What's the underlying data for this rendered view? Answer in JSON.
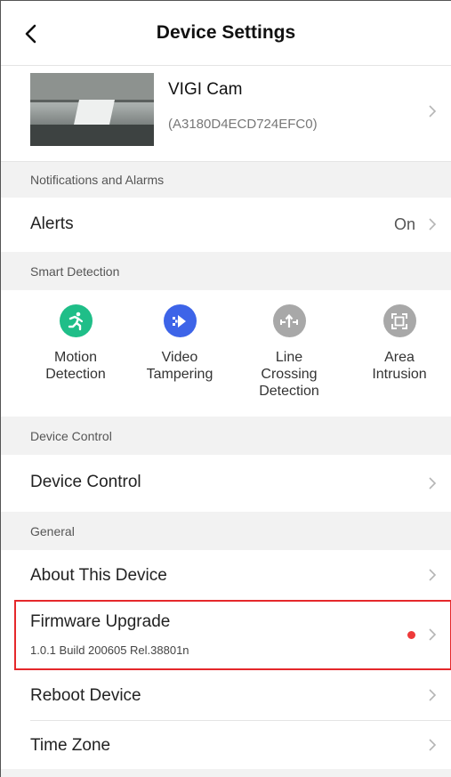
{
  "header": {
    "title": "Device Settings"
  },
  "device": {
    "name": "VIGI Cam",
    "id": "(A3180D4ECD724EFC0)"
  },
  "sections": {
    "notifications": "Notifications and Alarms",
    "smart_detection": "Smart Detection",
    "device_control": "Device Control",
    "general": "General"
  },
  "alerts": {
    "label": "Alerts",
    "value": "On"
  },
  "smart_features": [
    {
      "label": "Motion\nDetection",
      "icon": "running-person-icon",
      "color": "#1fbe88"
    },
    {
      "label": "Video\nTampering",
      "icon": "tamper-icon",
      "color": "#3d64e8"
    },
    {
      "label": "Line\nCrossing\nDetection",
      "icon": "line-crossing-icon",
      "color": "#a8a8a8"
    },
    {
      "label": "Area\nIntrusion",
      "icon": "area-intrusion-icon",
      "color": "#a8a8a8"
    }
  ],
  "device_control": {
    "label": "Device Control"
  },
  "general": {
    "about": "About This Device",
    "firmware": {
      "label": "Firmware Upgrade",
      "build": "1.0.1 Build 200605 Rel.38801n"
    },
    "reboot": "Reboot Device",
    "timezone": "Time Zone"
  },
  "colors": {
    "accent_red": "#e5282b",
    "dot_red": "#ee3a3a",
    "motion_green": "#1fbe88",
    "tamper_blue": "#3d64e8",
    "disabled_gray": "#a8a8a8"
  }
}
